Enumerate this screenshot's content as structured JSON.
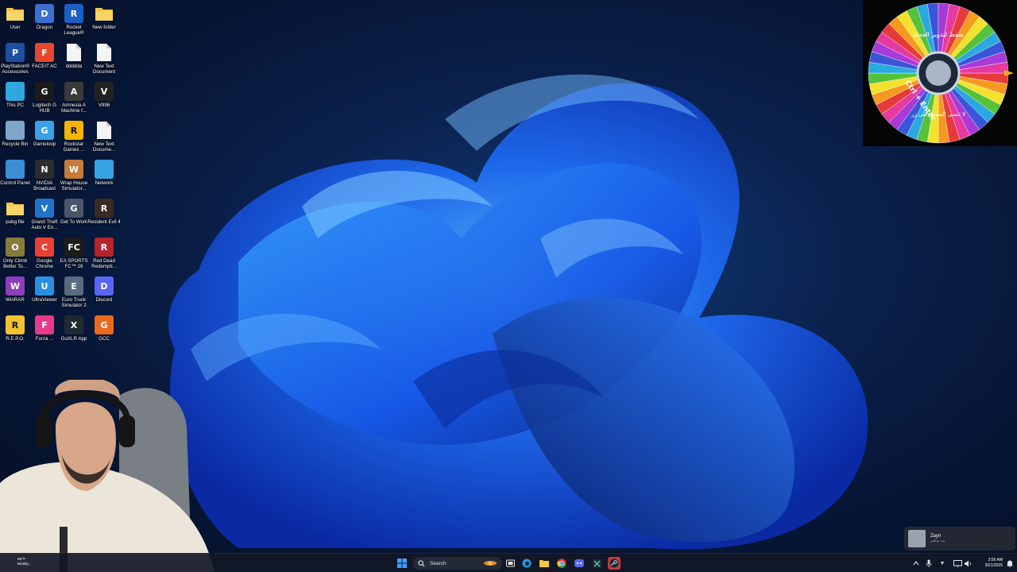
{
  "desktop_icons": [
    {
      "label": "User",
      "icon": "folder-icon",
      "color": "#f4c542",
      "glyph": ""
    },
    {
      "label": "Dragon",
      "icon": "dragon-app-icon",
      "color": "#3b6fd1",
      "glyph": "D"
    },
    {
      "label": "Rocket League®",
      "icon": "rocket-league-icon",
      "color": "#1b5fc4",
      "glyph": "R"
    },
    {
      "label": "New folder",
      "icon": "folder-icon",
      "color": "#f4c542",
      "glyph": ""
    },
    {
      "label": "PlayStation® Accessories",
      "icon": "playstation-icon",
      "color": "#1e4fa3",
      "glyph": "P"
    },
    {
      "label": "FACEIT AC",
      "icon": "faceit-icon",
      "color": "#e5482c",
      "glyph": "F"
    },
    {
      "label": "ddddda",
      "icon": "text-file-icon",
      "color": "#f2f2f2",
      "glyph": ""
    },
    {
      "label": "New Text Document",
      "icon": "text-file-icon",
      "color": "#f2f2f2",
      "glyph": ""
    },
    {
      "label": "This PC",
      "icon": "monitor-icon",
      "color": "#2fa8e0",
      "glyph": ""
    },
    {
      "label": "Logitech G HUB",
      "icon": "logitech-icon",
      "color": "#1a1a1a",
      "glyph": "G"
    },
    {
      "label": "Amnesia A Machine f...",
      "icon": "amnesia-icon",
      "color": "#3a3a3a",
      "glyph": "A"
    },
    {
      "label": "V896",
      "icon": "cat-icon",
      "color": "#222222",
      "glyph": "V"
    },
    {
      "label": "Recycle Bin",
      "icon": "recycle-bin-icon",
      "color": "#7ea6c9",
      "glyph": ""
    },
    {
      "label": "Gameloop",
      "icon": "gameloop-icon",
      "color": "#3aa0e8",
      "glyph": "G"
    },
    {
      "label": "Rockstar Games ...",
      "icon": "rockstar-icon",
      "color": "#f4b400",
      "glyph": "R"
    },
    {
      "label": "New Text Docume...",
      "icon": "text-file-icon",
      "color": "#f2f2f2",
      "glyph": ""
    },
    {
      "label": "Control Panel",
      "icon": "control-panel-icon",
      "color": "#3c8fd6",
      "glyph": ""
    },
    {
      "label": "NVIDIA Broadcast",
      "icon": "nvidia-icon",
      "color": "#2c2c2c",
      "glyph": "N"
    },
    {
      "label": "Wrap House Simulator...",
      "icon": "wrap-house-icon",
      "color": "#c77a3a",
      "glyph": "W"
    },
    {
      "label": "Network",
      "icon": "network-icon",
      "color": "#37a4e2",
      "glyph": ""
    },
    {
      "label": "pubg file",
      "icon": "folder-icon",
      "color": "#f4c542",
      "glyph": ""
    },
    {
      "label": "Grand Theft Auto V En...",
      "icon": "gta-icon",
      "color": "#1e73c9",
      "glyph": "V"
    },
    {
      "label": "Get To Work",
      "icon": "get-to-work-icon",
      "color": "#4a5566",
      "glyph": "G"
    },
    {
      "label": "Resident Evil 4",
      "icon": "resident-evil-icon",
      "color": "#3b2a22",
      "glyph": "R"
    },
    {
      "label": "Only Climb Better To...",
      "icon": "only-climb-icon",
      "color": "#8a7a3a",
      "glyph": "O"
    },
    {
      "label": "Google Chrome",
      "icon": "chrome-icon",
      "color": "#e94235",
      "glyph": "C"
    },
    {
      "label": "EA SPORTS FC™ 26",
      "icon": "ea-fc-icon",
      "color": "#1c1c1c",
      "glyph": "FC"
    },
    {
      "label": "Red Dead Redempti...",
      "icon": "red-dead-icon",
      "color": "#b5242a",
      "glyph": "R"
    },
    {
      "label": "WinRAR",
      "icon": "winrar-icon",
      "color": "#8c3fb8",
      "glyph": "W"
    },
    {
      "label": "UltraViewer",
      "icon": "ultraviewer-icon",
      "color": "#2a8fe0",
      "glyph": "U"
    },
    {
      "label": "Euro Truck Simulator 2",
      "icon": "euro-truck-icon",
      "color": "#5a6a80",
      "glyph": "E"
    },
    {
      "label": "Discord",
      "icon": "discord-icon",
      "color": "#5865f2",
      "glyph": "D"
    },
    {
      "label": "R.E.P.O.",
      "icon": "repo-icon",
      "color": "#f2c230",
      "glyph": "R"
    },
    {
      "label": "Forza ...",
      "icon": "forza-icon",
      "color": "#e63b8a",
      "glyph": "F"
    },
    {
      "label": "GoXLR App",
      "icon": "goxlr-icon",
      "color": "#1f2a33",
      "glyph": "X"
    },
    {
      "label": "GCC",
      "icon": "gcc-icon",
      "color": "#e96a1c",
      "glyph": "G"
    }
  ],
  "wheel": {
    "top_text": "ضغط لتدوير العجلة",
    "bottom_text": "لا تنسى الضغط على زر",
    "shortcut": "Ctrl + Enter",
    "colors": [
      "#e63a3a",
      "#f59a1f",
      "#f3e22c",
      "#56c23a",
      "#2aa8e0",
      "#3a56d8",
      "#a83ad8",
      "#e63aa0"
    ]
  },
  "notification": {
    "title": "Zayn",
    "subtitle": "بث مباشر"
  },
  "taskbar": {
    "search_label": "Search",
    "weather_temp": "69°F",
    "weather_desc": "Mostly...",
    "time": "3:56 AM",
    "date": "9/21/2025"
  },
  "colors": {
    "wallpaper_bg": "#071636",
    "ribbon_light": "#2e8dff",
    "ribbon_dark": "#0a2fb8",
    "taskbar_bg": "#121826"
  }
}
